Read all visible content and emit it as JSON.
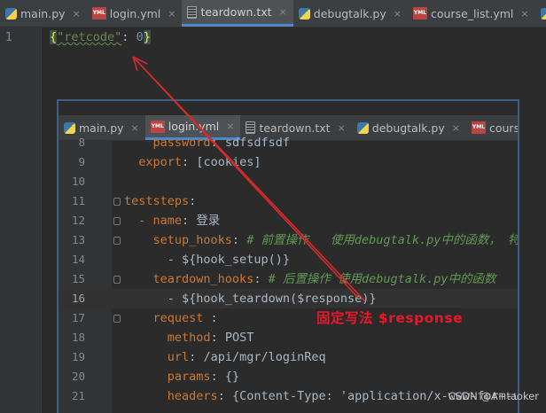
{
  "outer_tabs": [
    {
      "label": "main.py",
      "icon": "python-file-icon",
      "icon_text": ""
    },
    {
      "label": "login.yml",
      "icon": "yaml-file-icon",
      "icon_text": "YML"
    },
    {
      "label": "teardown.txt",
      "icon": "text-file-icon",
      "icon_text": "",
      "active": true
    },
    {
      "label": "debugtalk.py",
      "icon": "python-file-icon",
      "icon_text": ""
    },
    {
      "label": "course_list.yml",
      "icon": "yaml-file-icon",
      "icon_text": "YML"
    },
    {
      "label": "co",
      "icon": "python-file-icon",
      "icon_text": ""
    }
  ],
  "outer_editor": {
    "line_number": "1",
    "tokens": {
      "open": "{",
      "key": "\"retcode\"",
      "colon": ": ",
      "value": "0",
      "close": "}"
    }
  },
  "inset_tabs": [
    {
      "label": "main.py",
      "icon": "python-file-icon",
      "icon_text": ""
    },
    {
      "label": "login.yml",
      "icon": "yaml-file-icon",
      "icon_text": "YML",
      "active": true
    },
    {
      "label": "teardown.txt",
      "icon": "text-file-icon",
      "icon_text": ""
    },
    {
      "label": "debugtalk.py",
      "icon": "python-file-icon",
      "icon_text": ""
    },
    {
      "label": "cours",
      "icon": "yaml-file-icon",
      "icon_text": "YML"
    }
  ],
  "inset_lines": [
    {
      "n": "8",
      "indent": "    ",
      "key": "password",
      "sep": ": ",
      "val": "sdfsdfsdf",
      "kind": "kv"
    },
    {
      "n": "9",
      "indent": "  ",
      "key": "export",
      "sep": ": ",
      "val": "[cookies]",
      "kind": "kv"
    },
    {
      "n": "10",
      "indent": "",
      "key": "",
      "sep": "",
      "val": "",
      "kind": "blank"
    },
    {
      "n": "11",
      "indent": "",
      "key": "teststeps",
      "sep": ":",
      "val": "",
      "kind": "kv"
    },
    {
      "n": "12",
      "indent": "  ",
      "key": "- name",
      "sep": ": ",
      "val": "登录",
      "kind": "kv"
    },
    {
      "n": "13",
      "indent": "    ",
      "key": "setup_hooks",
      "sep": ": ",
      "val": "# 前置操作   使用debugtalk.py中的函数， 特殊",
      "kind": "comment"
    },
    {
      "n": "14",
      "indent": "      ",
      "key": "",
      "sep": "",
      "val": "- ${hook_setup()}",
      "kind": "plain"
    },
    {
      "n": "15",
      "indent": "    ",
      "key": "teardown_hooks",
      "sep": ": ",
      "val": "# 后置操作 使用debugtalk.py中的函数",
      "kind": "comment"
    },
    {
      "n": "16",
      "indent": "      ",
      "key": "",
      "sep": "",
      "val": "- ${hook_teardown($response)}",
      "kind": "plain",
      "current": true
    },
    {
      "n": "17",
      "indent": "    ",
      "key": "request",
      "sep": " :",
      "val": "",
      "kind": "kv"
    },
    {
      "n": "18",
      "indent": "      ",
      "key": "method",
      "sep": ": ",
      "val": "POST",
      "kind": "kv"
    },
    {
      "n": "19",
      "indent": "      ",
      "key": "url",
      "sep": ": ",
      "val": "/api/mgr/loginReq",
      "kind": "kv"
    },
    {
      "n": "20",
      "indent": "      ",
      "key": "params",
      "sep": ": ",
      "val": "{}",
      "kind": "kv"
    },
    {
      "n": "21",
      "indent": "      ",
      "key": "headers",
      "sep": ": ",
      "val": "{Content-Type: 'application/x-www-form-u",
      "kind": "kv"
    }
  ],
  "annotation": "固定写法  $response",
  "watermark": "CSDN @A~taoker",
  "colors": {
    "accent": "#4a88c7",
    "annotation": "#e8182a",
    "arrow": "#d42b2b"
  }
}
